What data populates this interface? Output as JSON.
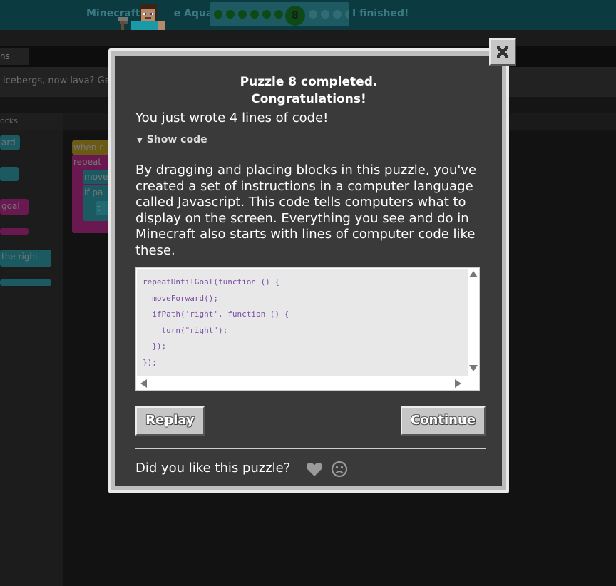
{
  "background": {
    "title_fragment_left": "Minecraft",
    "title_fragment_right": "e Aquatic",
    "progress": {
      "current_level": "8",
      "completed_before": 6,
      "remaining_after": 4
    },
    "finished_label": "I finished!",
    "tab_label": "ns",
    "instructions_fragment": "icebergs, now lava? Ge",
    "blocks_header": "ocks",
    "toolbox_blocks": [
      "ard",
      "",
      "goal",
      "",
      "the right",
      ""
    ],
    "workspace_blocks": [
      "when r",
      "repeat",
      "move",
      "if pa",
      "t"
    ]
  },
  "modal": {
    "title_line1": "Puzzle 8 completed.",
    "title_line2": "Congratulations!",
    "lines_of_code": "You just wrote 4 lines of code!",
    "show_code_label": "Show code",
    "description": "By dragging and placing blocks in this puzzle, you've created a set of instructions in a computer language called Javascript. This code tells computers what to display on the screen. Everything you see and do in Minecraft also starts with lines of computer code like these.",
    "code_lines": [
      "repeatUntilGoal(function () {",
      "  moveForward();",
      "  ifPath('right', function () {",
      "    turn(\"right\");",
      "  });",
      "});"
    ],
    "replay_label": "Replay",
    "continue_label": "Continue",
    "feedback_prompt": "Did you like this puzzle?",
    "icons": {
      "close": "close-icon",
      "like": "heart-icon",
      "dislike": "frown-icon"
    }
  },
  "colors": {
    "modal_bg": "#3a3a3a",
    "button_bg": "#c6c6c6",
    "code_text": "#7b4fa6",
    "progress_done": "#0d4a16"
  }
}
